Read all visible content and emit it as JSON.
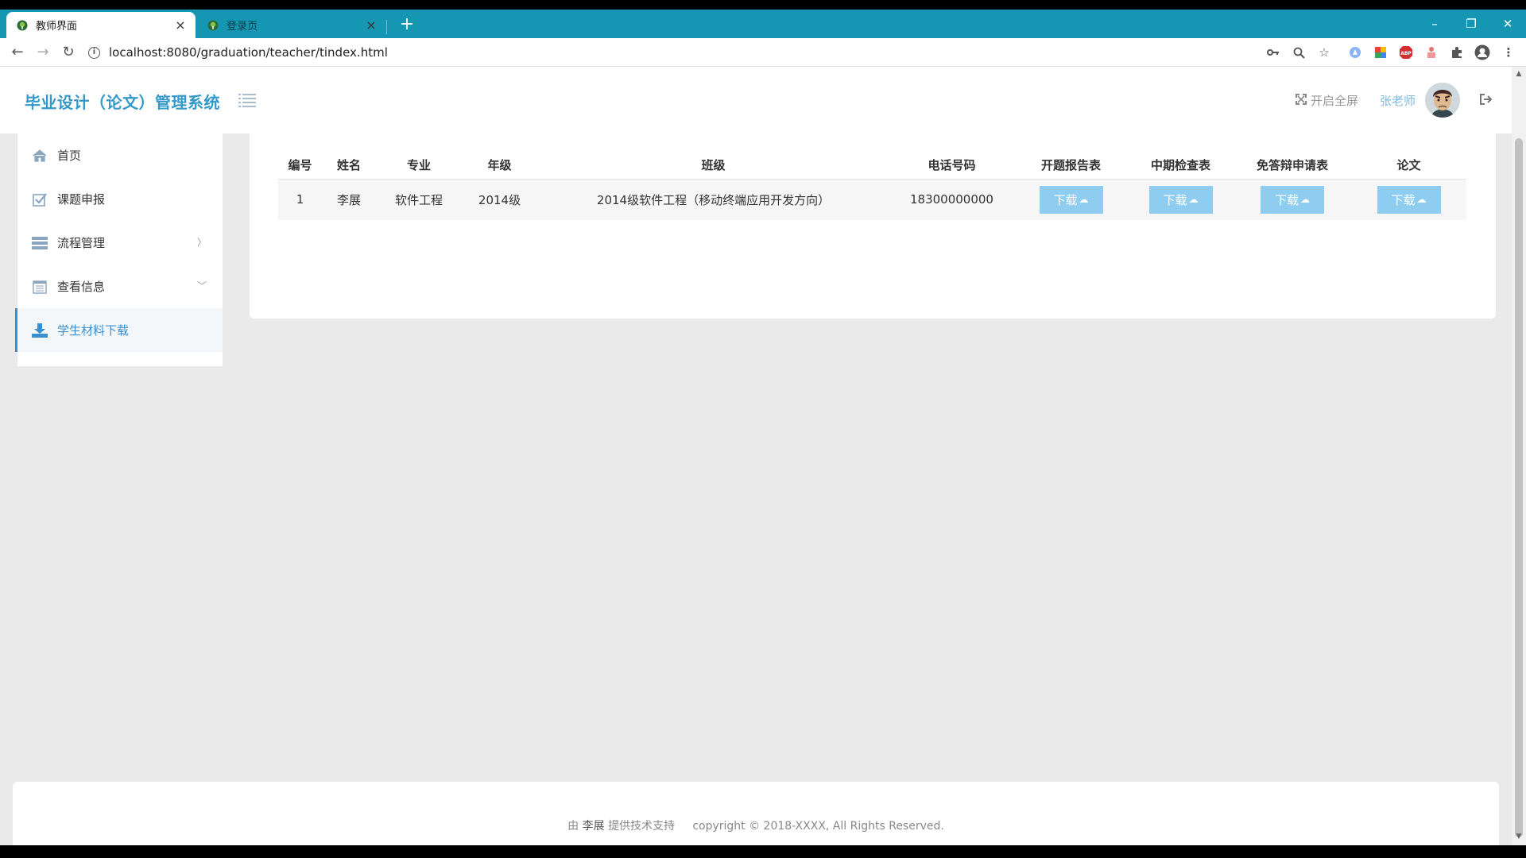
{
  "browser": {
    "tabs": [
      {
        "title": "教师界面",
        "active": true
      },
      {
        "title": "登录页",
        "active": false
      }
    ],
    "new_tab_label": "+",
    "url": "localhost:8080/graduation/teacher/tindex.html"
  },
  "header": {
    "app_title": "毕业设计（论文）管理系统",
    "fullscreen_label": "开启全屏",
    "username": "张老师"
  },
  "sidebar": {
    "items": [
      {
        "label": "首页",
        "icon": "home-icon"
      },
      {
        "label": "课题申报",
        "icon": "checkbox-icon"
      },
      {
        "label": "流程管理",
        "icon": "list-icon",
        "chevron": "right"
      },
      {
        "label": "查看信息",
        "icon": "calendar-icon",
        "chevron": "down"
      },
      {
        "label": "学生材料下载",
        "icon": "download-icon",
        "active": true
      }
    ]
  },
  "table": {
    "headers": [
      "编号",
      "姓名",
      "专业",
      "年级",
      "班级",
      "电话号码",
      "开题报告表",
      "中期检查表",
      "免答辩申请表",
      "论文"
    ],
    "rows": [
      {
        "id": "1",
        "name": "李展",
        "major": "软件工程",
        "grade": "2014级",
        "class": "2014级软件工程（移动终端应用开发方向）",
        "phone": "18300000000"
      }
    ],
    "download_label": "下载"
  },
  "footer": {
    "prefix": "由",
    "author": "李展",
    "suffix": "提供技术支持",
    "copyright": "copyright © 2018-XXXX, All Rights Reserved."
  },
  "colors": {
    "tabbar": "#1597b4",
    "accent": "#3498c9",
    "button": "#8ecdf0"
  }
}
